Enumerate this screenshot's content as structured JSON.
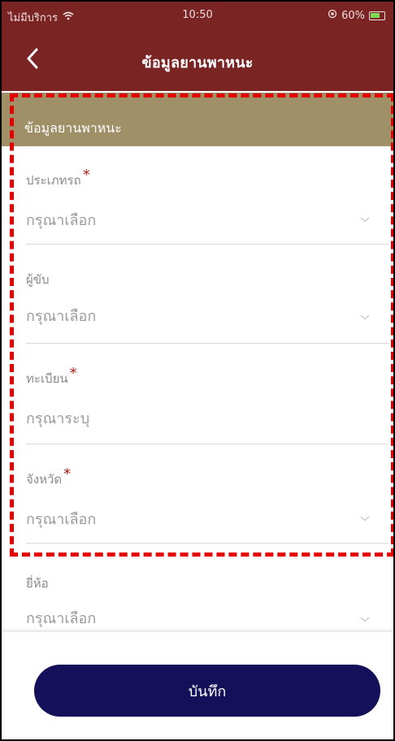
{
  "status": {
    "carrier": "ไม่มีบริการ",
    "time": "10:50",
    "battery": "60%"
  },
  "nav": {
    "title": "ข้อมูลยานพาหนะ"
  },
  "section": {
    "title": "ข้อมูลยานพาหนะ"
  },
  "fields": [
    {
      "label": "ประเภทรถ",
      "required": "*",
      "value": "กรุณาเลือก",
      "kind": "select"
    },
    {
      "label": "ผู้ขับ",
      "required": "",
      "value": "กรุณาเลือก",
      "kind": "select"
    },
    {
      "label": "ทะเบียน",
      "required": "*",
      "value": "กรุณาระบุ",
      "kind": "input"
    },
    {
      "label": "จังหวัด",
      "required": "*",
      "value": "กรุณาเลือก",
      "kind": "select"
    },
    {
      "label": "ยี่ห้อ",
      "required": "",
      "value": "กรุณาเลือก",
      "kind": "select"
    }
  ],
  "actions": {
    "save_label": "บันทึก"
  },
  "colors": {
    "nav": "#7a2424",
    "section": "#9f9068",
    "button": "#15105a",
    "highlight": "#e40000"
  }
}
